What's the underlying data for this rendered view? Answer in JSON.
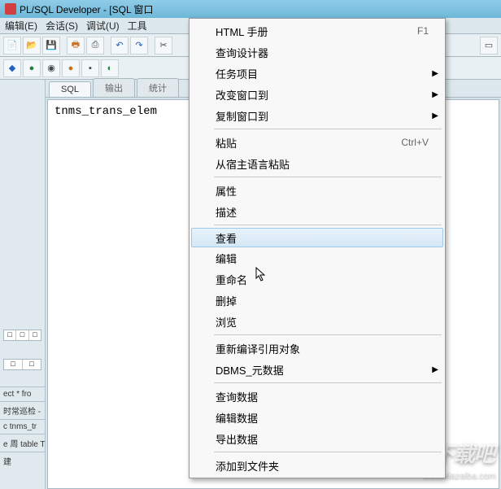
{
  "window": {
    "title": "PL/SQL Developer - [SQL 窗口"
  },
  "menubar": {
    "items": [
      "编辑(E)",
      "会话(S)",
      "调试(U)",
      "工具"
    ]
  },
  "tabs": {
    "sql": "SQL",
    "output": "输出",
    "stats": "统计"
  },
  "editor": {
    "content": "tnms_trans_elem"
  },
  "sidebar": {
    "frag1": "ect * fro",
    "frag2": "时常巡检 -",
    "frag3": "c tnms_tr",
    "frag4": "e 周 table T",
    "frag5": "建"
  },
  "context_menu": {
    "html_manual": {
      "label": "HTML 手册",
      "accel": "F1"
    },
    "query_designer": "查询设计器",
    "task_items": "任务项目",
    "change_window_to": "改变窗口到",
    "copy_window_to": "复制窗口到",
    "paste": {
      "label": "粘贴",
      "accel": "Ctrl+V"
    },
    "paste_from_host": "从宿主语言粘贴",
    "properties": "属性",
    "describe": "描述",
    "view": "查看",
    "edit": "编辑",
    "rename": "重命名",
    "delete": "删掉",
    "browse": "浏览",
    "recompile_refs": "重新编译引用对象",
    "dbms_metadata": "DBMS_元数据",
    "query_data": "查询数据",
    "edit_data": "编辑数据",
    "export_data": "导出数据",
    "add_to_folder": "添加到文件夹"
  },
  "watermark": {
    "logo": "下载吧",
    "url": "www.xiazaiba.com"
  }
}
